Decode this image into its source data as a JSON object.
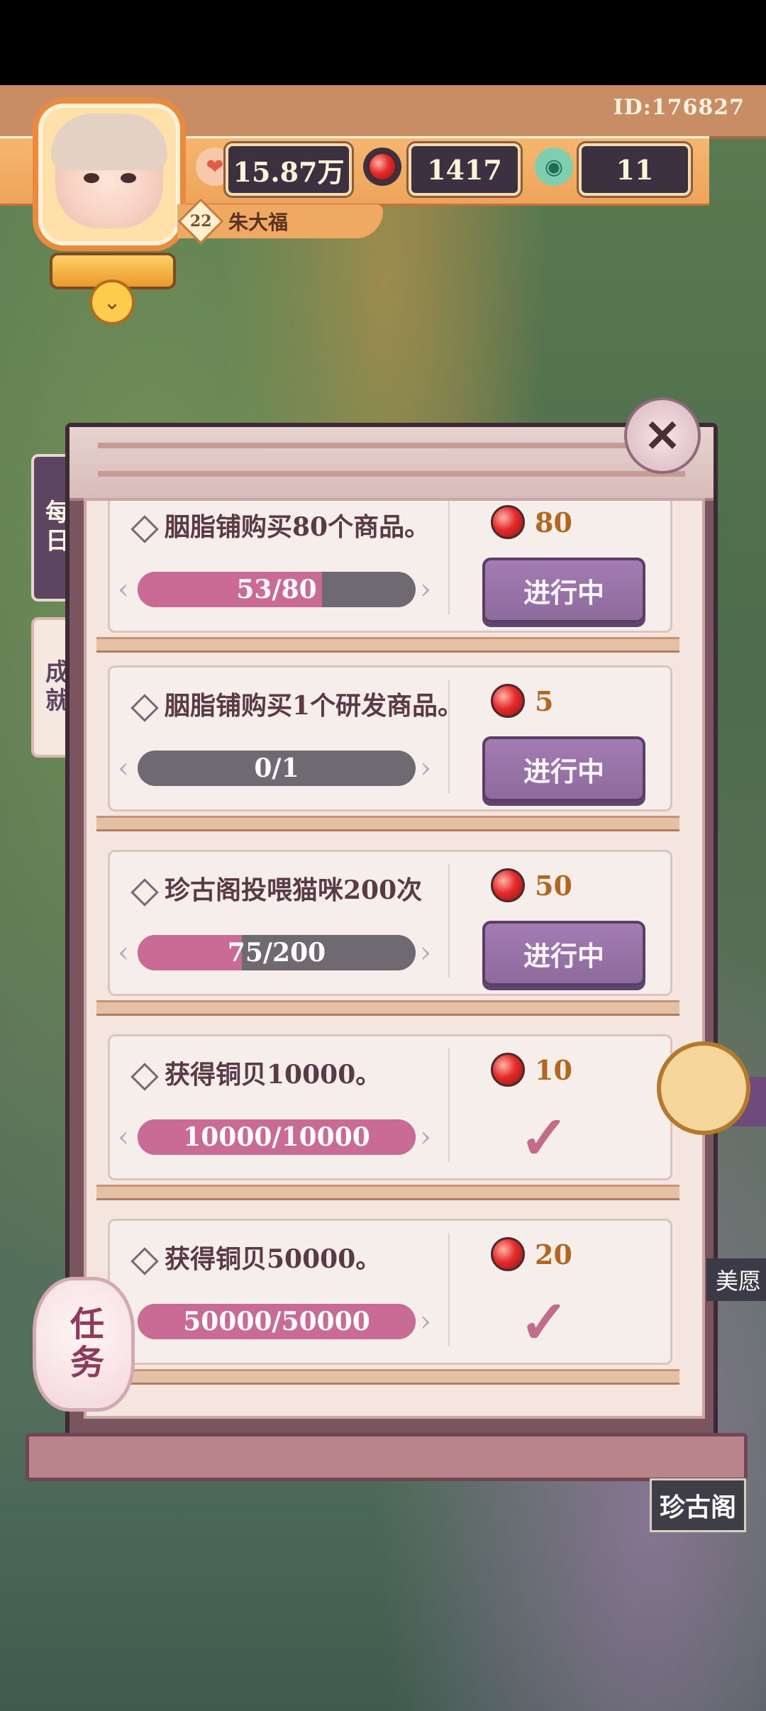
{
  "header": {
    "player_id": "ID:176827",
    "player_name": "朱大福",
    "level": "22",
    "resources": [
      {
        "name": "heart-coin",
        "value": "15.87万",
        "icon": "heart-coin-icon",
        "color": "#f1694e"
      },
      {
        "name": "ruby",
        "value": "1417",
        "icon": "ruby-icon",
        "color": "#e52b2b"
      },
      {
        "name": "jade",
        "value": "11",
        "icon": "jade-coin-icon",
        "color": "#4bb58f"
      }
    ]
  },
  "side_tabs": [
    {
      "label": "每日",
      "active": true
    },
    {
      "label": "成就",
      "active": false
    }
  ],
  "tasks": [
    {
      "title": "胭脂铺购买80个商品。",
      "reward": "80",
      "progress_text": "53/80",
      "progress": 0.6625,
      "status": "in_progress",
      "button": "进行中"
    },
    {
      "title": "胭脂铺购买1个研发商品。",
      "reward": "5",
      "progress_text": "0/1",
      "progress": 0.0,
      "status": "in_progress",
      "button": "进行中"
    },
    {
      "title": "珍古阁投喂猫咪200次",
      "reward": "50",
      "progress_text": "75/200",
      "progress": 0.375,
      "status": "in_progress",
      "button": "进行中"
    },
    {
      "title": "获得铜贝10000。",
      "reward": "10",
      "progress_text": "10000/10000",
      "progress": 1.0,
      "status": "completed",
      "button": ""
    },
    {
      "title": "获得铜贝50000。",
      "reward": "20",
      "progress_text": "50000/50000",
      "progress": 1.0,
      "status": "completed",
      "button": ""
    }
  ],
  "lantern_label": "任务",
  "close_label": "✕",
  "map_signs": {
    "zhengu": "珍古阁",
    "meiyuan": "美愿"
  },
  "colors": {
    "accent": "#5c4560",
    "progress_fill": "#c96b95",
    "button": "#8e6a9d"
  }
}
